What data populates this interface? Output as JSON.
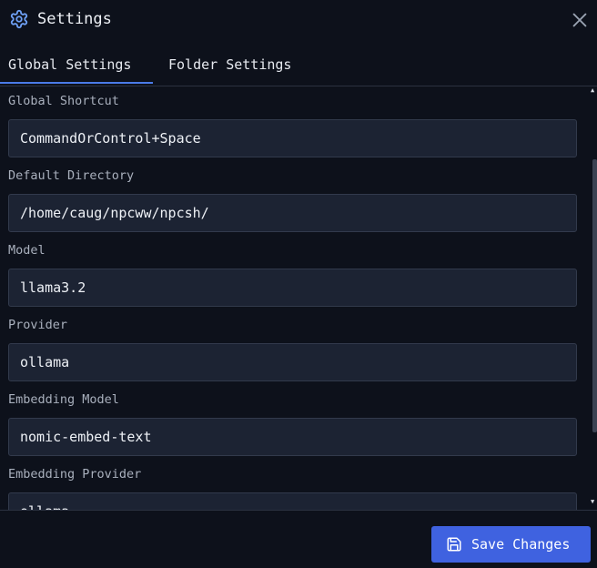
{
  "header": {
    "title": "Settings",
    "icon": "gear-icon",
    "close_icon": "close-icon"
  },
  "tabs": [
    {
      "label": "Global Settings",
      "active": true
    },
    {
      "label": "Folder Settings",
      "active": false
    }
  ],
  "fields": [
    {
      "label": "Global Shortcut",
      "value": "CommandOrControl+Space"
    },
    {
      "label": "Default Directory",
      "value": "/home/caug/npcww/npcsh/"
    },
    {
      "label": "Model",
      "value": "llama3.2"
    },
    {
      "label": "Provider",
      "value": "ollama"
    },
    {
      "label": "Embedding Model",
      "value": "nomic-embed-text"
    },
    {
      "label": "Embedding Provider",
      "value": "ollama"
    }
  ],
  "footer": {
    "save_label": "Save Changes",
    "save_icon": "save-icon"
  },
  "colors": {
    "background": "#0d111b",
    "input_background": "#1c2333",
    "accent": "#3f62e0",
    "tab_underline": "#4a7be8"
  }
}
